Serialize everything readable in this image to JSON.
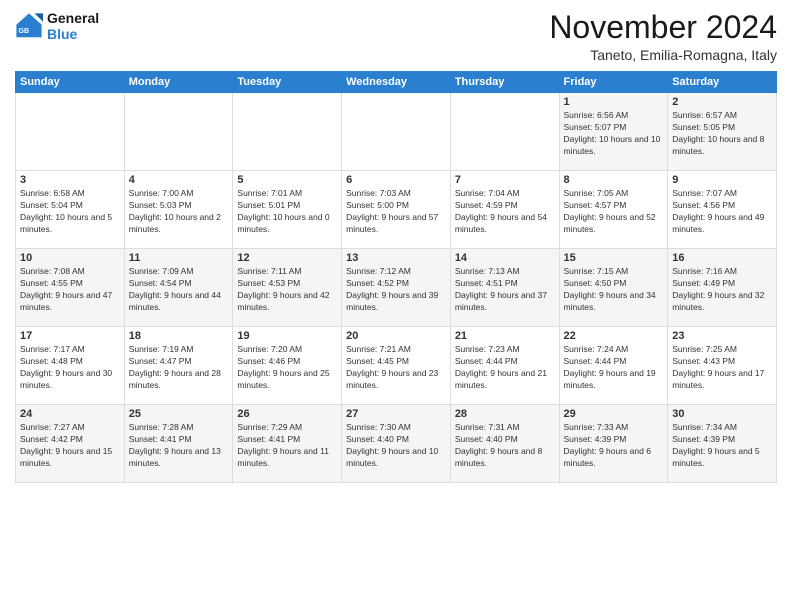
{
  "logo": {
    "line1": "General",
    "line2": "Blue"
  },
  "title": "November 2024",
  "subtitle": "Taneto, Emilia-Romagna, Italy",
  "days_header": [
    "Sunday",
    "Monday",
    "Tuesday",
    "Wednesday",
    "Thursday",
    "Friday",
    "Saturday"
  ],
  "weeks": [
    [
      {
        "day": "",
        "info": ""
      },
      {
        "day": "",
        "info": ""
      },
      {
        "day": "",
        "info": ""
      },
      {
        "day": "",
        "info": ""
      },
      {
        "day": "",
        "info": ""
      },
      {
        "day": "1",
        "info": "Sunrise: 6:56 AM\nSunset: 5:07 PM\nDaylight: 10 hours and 10 minutes."
      },
      {
        "day": "2",
        "info": "Sunrise: 6:57 AM\nSunset: 5:05 PM\nDaylight: 10 hours and 8 minutes."
      }
    ],
    [
      {
        "day": "3",
        "info": "Sunrise: 6:58 AM\nSunset: 5:04 PM\nDaylight: 10 hours and 5 minutes."
      },
      {
        "day": "4",
        "info": "Sunrise: 7:00 AM\nSunset: 5:03 PM\nDaylight: 10 hours and 2 minutes."
      },
      {
        "day": "5",
        "info": "Sunrise: 7:01 AM\nSunset: 5:01 PM\nDaylight: 10 hours and 0 minutes."
      },
      {
        "day": "6",
        "info": "Sunrise: 7:03 AM\nSunset: 5:00 PM\nDaylight: 9 hours and 57 minutes."
      },
      {
        "day": "7",
        "info": "Sunrise: 7:04 AM\nSunset: 4:59 PM\nDaylight: 9 hours and 54 minutes."
      },
      {
        "day": "8",
        "info": "Sunrise: 7:05 AM\nSunset: 4:57 PM\nDaylight: 9 hours and 52 minutes."
      },
      {
        "day": "9",
        "info": "Sunrise: 7:07 AM\nSunset: 4:56 PM\nDaylight: 9 hours and 49 minutes."
      }
    ],
    [
      {
        "day": "10",
        "info": "Sunrise: 7:08 AM\nSunset: 4:55 PM\nDaylight: 9 hours and 47 minutes."
      },
      {
        "day": "11",
        "info": "Sunrise: 7:09 AM\nSunset: 4:54 PM\nDaylight: 9 hours and 44 minutes."
      },
      {
        "day": "12",
        "info": "Sunrise: 7:11 AM\nSunset: 4:53 PM\nDaylight: 9 hours and 42 minutes."
      },
      {
        "day": "13",
        "info": "Sunrise: 7:12 AM\nSunset: 4:52 PM\nDaylight: 9 hours and 39 minutes."
      },
      {
        "day": "14",
        "info": "Sunrise: 7:13 AM\nSunset: 4:51 PM\nDaylight: 9 hours and 37 minutes."
      },
      {
        "day": "15",
        "info": "Sunrise: 7:15 AM\nSunset: 4:50 PM\nDaylight: 9 hours and 34 minutes."
      },
      {
        "day": "16",
        "info": "Sunrise: 7:16 AM\nSunset: 4:49 PM\nDaylight: 9 hours and 32 minutes."
      }
    ],
    [
      {
        "day": "17",
        "info": "Sunrise: 7:17 AM\nSunset: 4:48 PM\nDaylight: 9 hours and 30 minutes."
      },
      {
        "day": "18",
        "info": "Sunrise: 7:19 AM\nSunset: 4:47 PM\nDaylight: 9 hours and 28 minutes."
      },
      {
        "day": "19",
        "info": "Sunrise: 7:20 AM\nSunset: 4:46 PM\nDaylight: 9 hours and 25 minutes."
      },
      {
        "day": "20",
        "info": "Sunrise: 7:21 AM\nSunset: 4:45 PM\nDaylight: 9 hours and 23 minutes."
      },
      {
        "day": "21",
        "info": "Sunrise: 7:23 AM\nSunset: 4:44 PM\nDaylight: 9 hours and 21 minutes."
      },
      {
        "day": "22",
        "info": "Sunrise: 7:24 AM\nSunset: 4:44 PM\nDaylight: 9 hours and 19 minutes."
      },
      {
        "day": "23",
        "info": "Sunrise: 7:25 AM\nSunset: 4:43 PM\nDaylight: 9 hours and 17 minutes."
      }
    ],
    [
      {
        "day": "24",
        "info": "Sunrise: 7:27 AM\nSunset: 4:42 PM\nDaylight: 9 hours and 15 minutes."
      },
      {
        "day": "25",
        "info": "Sunrise: 7:28 AM\nSunset: 4:41 PM\nDaylight: 9 hours and 13 minutes."
      },
      {
        "day": "26",
        "info": "Sunrise: 7:29 AM\nSunset: 4:41 PM\nDaylight: 9 hours and 11 minutes."
      },
      {
        "day": "27",
        "info": "Sunrise: 7:30 AM\nSunset: 4:40 PM\nDaylight: 9 hours and 10 minutes."
      },
      {
        "day": "28",
        "info": "Sunrise: 7:31 AM\nSunset: 4:40 PM\nDaylight: 9 hours and 8 minutes."
      },
      {
        "day": "29",
        "info": "Sunrise: 7:33 AM\nSunset: 4:39 PM\nDaylight: 9 hours and 6 minutes."
      },
      {
        "day": "30",
        "info": "Sunrise: 7:34 AM\nSunset: 4:39 PM\nDaylight: 9 hours and 5 minutes."
      }
    ]
  ]
}
